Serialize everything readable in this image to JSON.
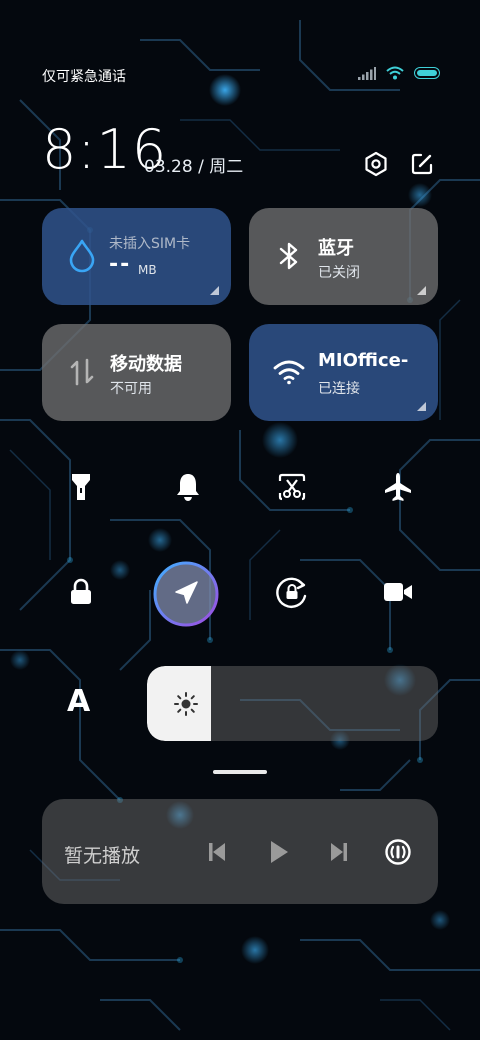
{
  "status": {
    "carrier_text": "仅可紧急通话"
  },
  "clock": {
    "time": "8:16",
    "date": "03.28 / 周二"
  },
  "tiles": {
    "data_usage": {
      "label": "未插入SIM卡",
      "value": "--",
      "unit": "MB"
    },
    "bluetooth": {
      "title": "蓝牙",
      "state": "已关闭"
    },
    "mobile_data": {
      "title": "移动数据",
      "state": "不可用"
    },
    "wifi": {
      "title": "MIOffice-",
      "state": "已连接"
    }
  },
  "quick_toggles_row1": [
    "flashlight-icon",
    "bell-icon",
    "screenshot-icon",
    "airplane-icon"
  ],
  "quick_toggles_row2": [
    "lock-icon",
    "location-icon",
    "rotation-lock-icon",
    "video-icon"
  ],
  "brightness": {
    "auto_label": "A",
    "level": 0.22
  },
  "media": {
    "label": "暂无播放"
  },
  "colors": {
    "accent": "#3fd0d8",
    "tile_blue": "#30548c",
    "tile_gray": "#707070",
    "water_icon": "#39a5f5"
  }
}
